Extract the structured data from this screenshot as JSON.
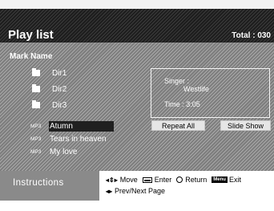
{
  "header": {
    "title": "Play list",
    "total": "Total : 030"
  },
  "list": {
    "mark_label": "Mark",
    "name_label": "Name",
    "directories": [
      "Dir1",
      "Dir2",
      "Dir3"
    ],
    "tracks": [
      {
        "type": "MP3",
        "name": "Atumn"
      },
      {
        "type": "MP3",
        "name": "Tears in heaven"
      },
      {
        "type": "MP3",
        "name": "My love"
      }
    ]
  },
  "info": {
    "singer_label": "Singer :",
    "singer": "Westlife",
    "time_label": "Time :",
    "time": "3:05"
  },
  "buttons": {
    "repeat": "Repeat All",
    "slideshow": "Slide Show"
  },
  "instructions": {
    "title": "Instructions",
    "move_key": "◂⇕▸",
    "move": "Move",
    "enter": "Enter",
    "return": "Return",
    "exit_key": "Menu",
    "exit": "Exit",
    "page_key": "◂▸",
    "page": "Prev/Next Page"
  }
}
